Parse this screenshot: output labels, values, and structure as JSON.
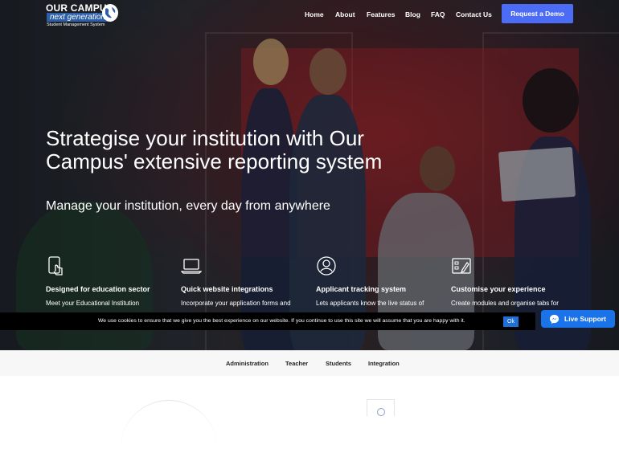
{
  "logo": {
    "line1": "OUR CAMPUS",
    "line2": "next generation",
    "line3": "Student Management System"
  },
  "nav": {
    "items": [
      {
        "label": "Home"
      },
      {
        "label": "About"
      },
      {
        "label": "Features"
      },
      {
        "label": "Blog"
      },
      {
        "label": "FAQ"
      },
      {
        "label": "Contact Us"
      }
    ],
    "cta": "Request a Demo"
  },
  "hero": {
    "headline": "Strategise your institution with Our Campus' extensive reporting system",
    "subline": "Manage your institution, every day from anywhere"
  },
  "features": [
    {
      "icon": "touch-phone-icon",
      "title": "Designed for education sector",
      "desc": "Meet your Educational Institution"
    },
    {
      "icon": "laptop-icon",
      "title": "Quick website integrations",
      "desc": "Incorporate your application forms and"
    },
    {
      "icon": "user-circle-icon",
      "title": "Applicant tracking system",
      "desc": "Lets applicants know the live status of"
    },
    {
      "icon": "customize-icon",
      "title": "Customise your experience",
      "desc": "Create modules and organise tabs for"
    }
  ],
  "cookie": {
    "text": "We use cookies to ensure that we give you the best experience on our website. If you continue to use this site we will assume that you are happy with it.",
    "ok": "Ok"
  },
  "live_support": {
    "label": "Live Support"
  },
  "tabs": [
    {
      "label": "Administration"
    },
    {
      "label": "Teacher"
    },
    {
      "label": "Students"
    },
    {
      "label": "Integration"
    }
  ],
  "colors": {
    "accent": "#4d6cf5",
    "live_support": "#1a73e8",
    "cookie_ok": "#1f6fd4"
  }
}
